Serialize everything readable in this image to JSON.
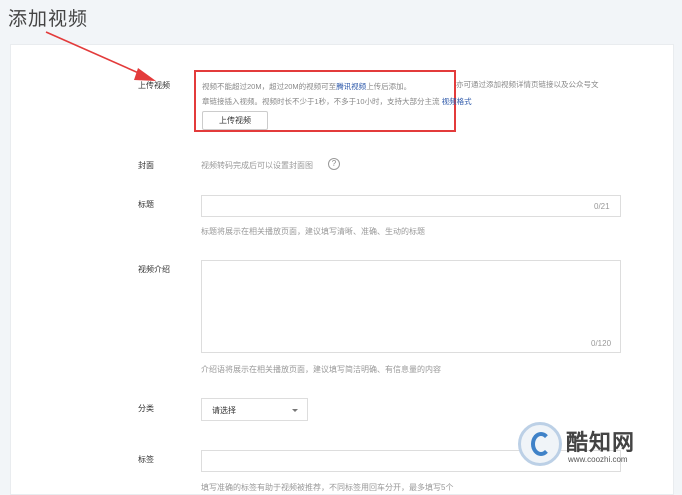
{
  "page": {
    "title": "添加视频"
  },
  "upload": {
    "label": "上传视频",
    "desc_part1": "视频不能超过20M，超过20M的视频可至",
    "desc_link1": "腾讯视频",
    "desc_part2": "上传后添加。",
    "desc_part3": "亦可通过添加视频详情页链接以及公众号文",
    "desc_line2": "章链接插入视频。视频时长不少于1秒，不多于10小时，支持大部分主流 ",
    "desc_link2": "视频格式",
    "button_label": "上传视频"
  },
  "cover": {
    "label": "封面",
    "hint": "视频转码完成后可以设置封面图",
    "help_icon_glyph": "?"
  },
  "title_field": {
    "label": "标题",
    "counter": "0/21",
    "hint": "标题将展示在相关播放页面，建议填写清晰、准确、生动的标题"
  },
  "intro": {
    "label": "视频介绍",
    "counter": "0/120",
    "hint": "介绍语将展示在相关播放页面，建议填写简洁明确、有信息量的内容"
  },
  "category": {
    "label": "分类",
    "selected": "请选择"
  },
  "tags": {
    "label": "标签",
    "hint": "填写准确的标签有助于视频被推荐，不同标签用回车分开，最多填写5个"
  },
  "watermark": {
    "title": "酷知网",
    "url": "www.coozhi.com"
  },
  "colors": {
    "highlight_border": "#e33b3b",
    "link": "#2a56a8",
    "background": "#f2f5f8"
  }
}
